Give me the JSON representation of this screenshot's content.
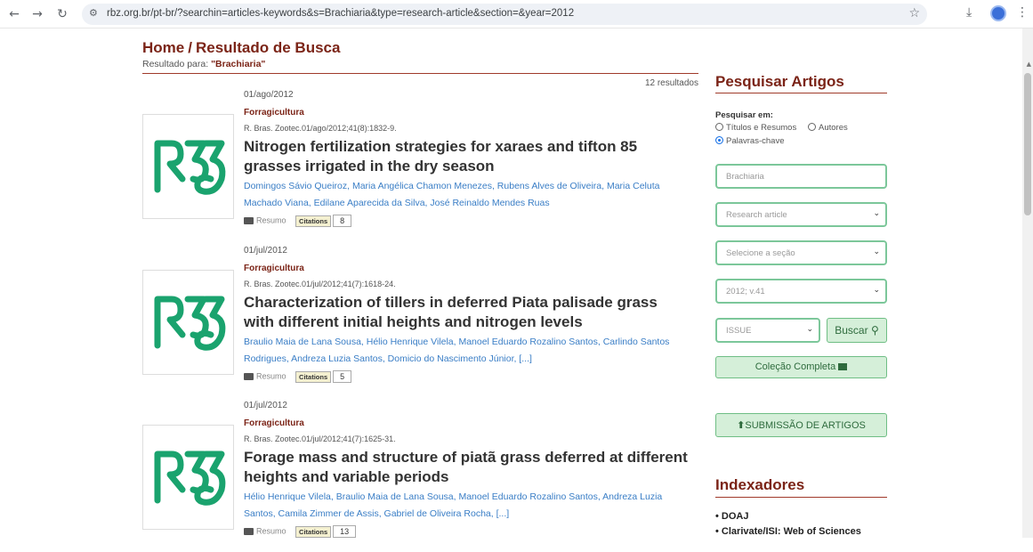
{
  "browser": {
    "url": "rbz.org.br/pt-br/?searchin=articles-keywords&s=Brachiaria&type=research-article&section=&year=2012"
  },
  "page": {
    "home": "Home",
    "separator": "/",
    "title": "Resultado de Busca",
    "result_prefix": "Resultado para:",
    "query": "\"Brachiaria\"",
    "count": "12 resultados"
  },
  "articles": [
    {
      "date": "01/ago/2012",
      "section": "Forragicultura",
      "ref": "R. Bras. Zootec.01/ago/2012;41(8):1832-9.",
      "title": "Nitrogen fertilization strategies for xaraes and tifton 85 grasses irrigated in the dry season",
      "authors": "Domingos Sávio Queiroz, Maria Angélica Chamon Menezes, Rubens Alves de Oliveira, Maria Celuta Machado Viana, Edilane Aparecida da Silva, José Reinaldo Mendes Ruas",
      "resumo": "Resumo",
      "citations_label": "Citations",
      "citations": "8"
    },
    {
      "date": "01/jul/2012",
      "section": "Forragicultura",
      "ref": "R. Bras. Zootec.01/jul/2012;41(7):1618-24.",
      "title": "Characterization of tillers in deferred Piata palisade grass with different initial heights and nitrogen levels",
      "authors": "Braulio Maia de Lana Sousa, Hélio Henrique Vilela, Manoel Eduardo Rozalino Santos, Carlindo Santos Rodrigues, Andreza Luzia Santos, Domicio do Nascimento Júnior, [...]",
      "resumo": "Resumo",
      "citations_label": "Citations",
      "citations": "5"
    },
    {
      "date": "01/jul/2012",
      "section": "Forragicultura",
      "ref": "R. Bras. Zootec.01/jul/2012;41(7):1625-31.",
      "title": "Forage mass and structure of piatã grass deferred at different heights and variable periods",
      "authors": "Hélio Henrique Vilela, Braulio Maia de Lana Sousa, Manoel Eduardo Rozalino Santos, Andreza Luzia Santos, Camila Zimmer de Assis, Gabriel de Oliveira Rocha, [...]",
      "resumo": "Resumo",
      "citations_label": "Citations",
      "citations": "13"
    }
  ],
  "sidebar": {
    "title": "Pesquisar Artigos",
    "search_in": "Pesquisar em:",
    "radio_titles": "Títulos e Resumos",
    "radio_authors": "Autores",
    "radio_keywords": "Palavras-chave",
    "keyword_placeholder": "Brachiaria",
    "type_select": "Research article",
    "section_select": "Selecione a seção",
    "year_select": "2012; v.41",
    "issue_select": "ISSUE",
    "search_button": "Buscar",
    "collection_button": "Coleção Completa",
    "submit_button": "SUBMISSÃO DE ARTIGOS",
    "indexers_title": "Indexadores",
    "indexers": [
      "DOAJ",
      "Clarivate/ISI: Web of Sciences"
    ]
  },
  "colors": {
    "brand": "#7b2417",
    "logo": "#1aa36e",
    "link": "#3a7ec6",
    "button_green": "#d5efd9"
  }
}
